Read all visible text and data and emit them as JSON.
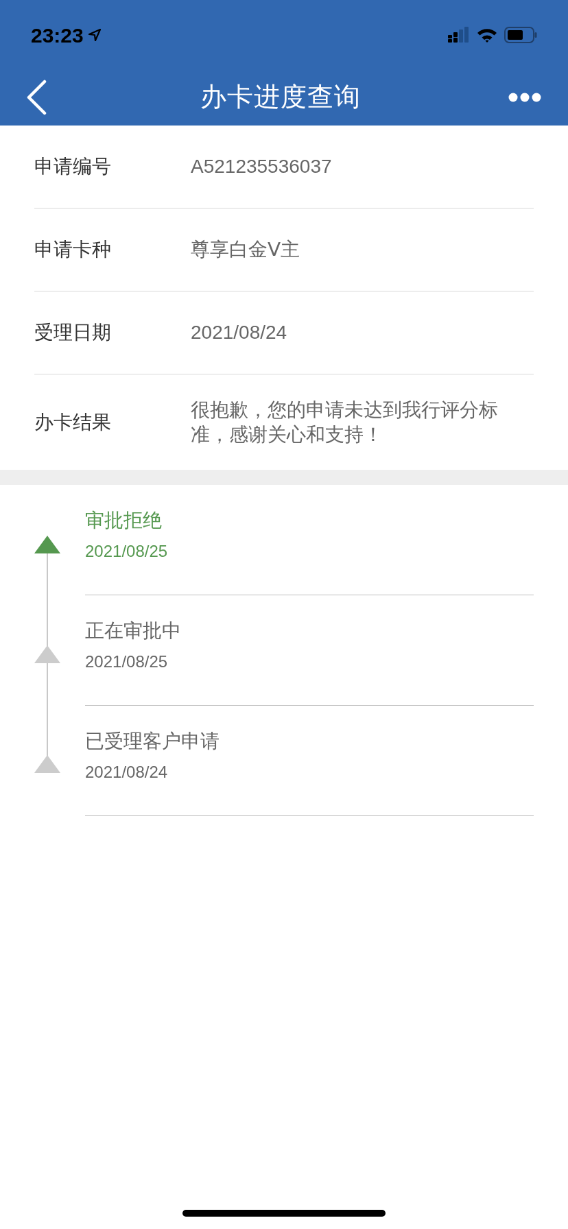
{
  "status_bar": {
    "time": "23:23"
  },
  "nav_bar": {
    "title": "办卡进度查询"
  },
  "details": [
    {
      "label": "申请编号",
      "value": "A521235536037"
    },
    {
      "label": "申请卡种",
      "value": "尊享白金Ⅴ主"
    },
    {
      "label": "受理日期",
      "value": "2021/08/24"
    },
    {
      "label": "办卡结果",
      "value": "很抱歉，您的申请未达到我行评分标准，感谢关心和支持！"
    }
  ],
  "timeline": [
    {
      "title": "审批拒绝",
      "date": "2021/08/25",
      "current": true
    },
    {
      "title": "正在审批中",
      "date": "2021/08/25",
      "current": false
    },
    {
      "title": "已受理客户申请",
      "date": "2021/08/24",
      "current": false
    }
  ]
}
